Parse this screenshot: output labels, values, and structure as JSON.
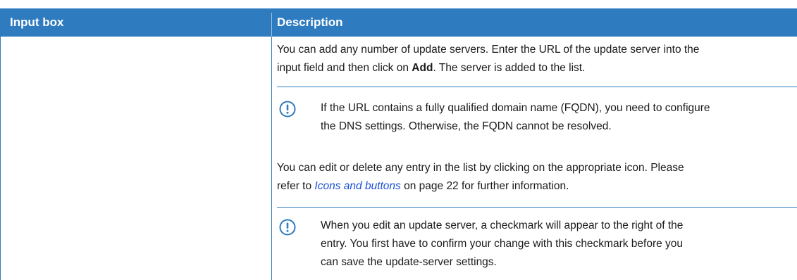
{
  "table": {
    "header_input_box": "Input box",
    "header_description": "Description"
  },
  "para1": {
    "line1": "You can add any number of update servers. Enter the URL of the update server into the",
    "line2_pre": "input field and then click on ",
    "line2_bold": "Add",
    "line2_post": ". The server is added to the list."
  },
  "note1": {
    "line1": "If the URL contains a fully qualified domain name (FQDN), you need to configure",
    "line2": "the DNS settings. Otherwise, the FQDN cannot be resolved."
  },
  "para2": {
    "line1": "You can edit or delete any entry in the list by clicking on the appropriate icon. Please",
    "line2_pre": "refer to ",
    "line2_link": "Icons and buttons",
    "line2_post": " on page 22 for further information."
  },
  "note2": {
    "line1": "When you edit an update server, a checkmark will appear to the right of the",
    "line2": "entry. You first have to confirm your change with this checkmark before you",
    "line3": "can save the update-server settings."
  },
  "colors": {
    "header_bg": "#2f7bc0",
    "rule": "#2f7bc0",
    "link": "#1a4fd6"
  },
  "icons": {
    "note_icon": "exclamation-circle-icon"
  }
}
